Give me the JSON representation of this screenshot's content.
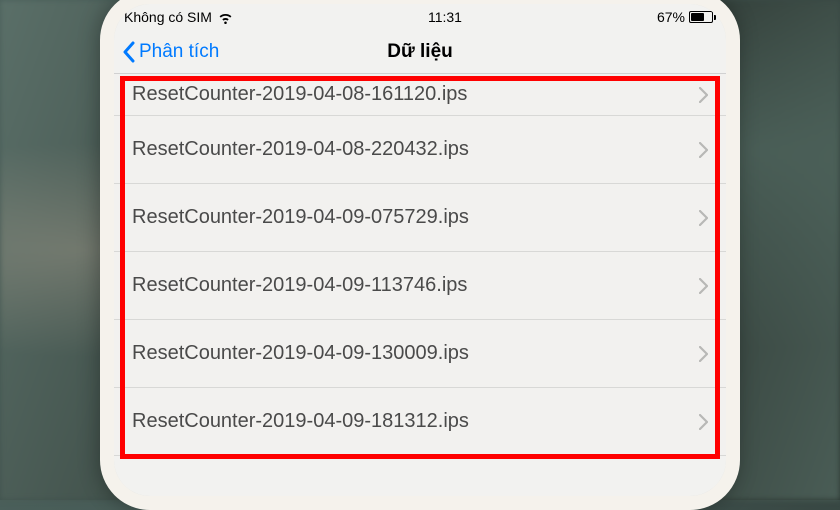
{
  "status_bar": {
    "carrier": "Không có SIM",
    "time": "11:31",
    "battery_percent": "67%"
  },
  "nav": {
    "back_label": "Phân tích",
    "title": "Dữ liệu"
  },
  "list": {
    "items": [
      {
        "label": "ResetCounter-2019-04-08-161120.ips"
      },
      {
        "label": "ResetCounter-2019-04-08-220432.ips"
      },
      {
        "label": "ResetCounter-2019-04-09-075729.ips"
      },
      {
        "label": "ResetCounter-2019-04-09-113746.ips"
      },
      {
        "label": "ResetCounter-2019-04-09-130009.ips"
      },
      {
        "label": "ResetCounter-2019-04-09-181312.ips"
      }
    ]
  },
  "colors": {
    "accent": "#007aff",
    "highlight": "#ff0000"
  }
}
